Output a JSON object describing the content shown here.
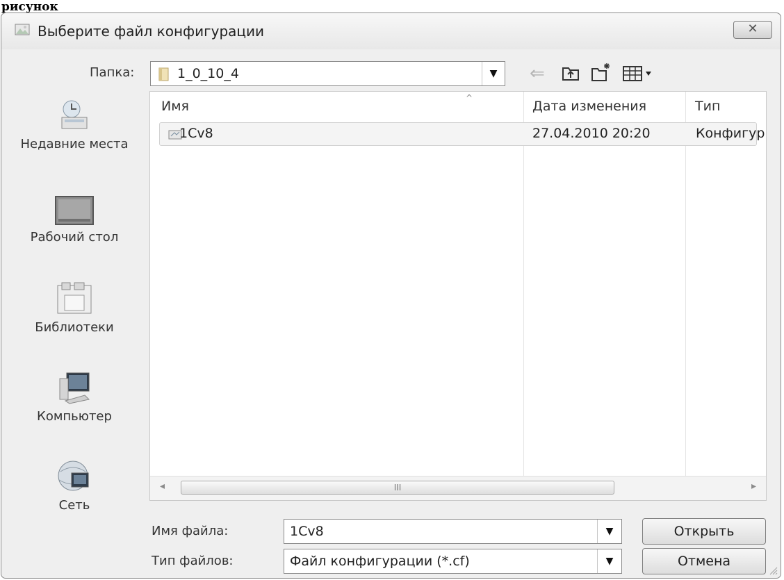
{
  "caption": "рисунок",
  "dialog": {
    "title": "Выберите файл конфигурации",
    "close_glyph": "✕"
  },
  "folder_bar": {
    "label": "Папка:",
    "current_folder": "1_0_10_4",
    "back_icon": "back-arrow-icon",
    "up_icon": "folder-up-icon",
    "new_folder_icon": "new-folder-icon",
    "view_icon": "view-menu-icon"
  },
  "places": [
    {
      "label": "Недавние места",
      "icon": "recent-places-icon"
    },
    {
      "label": "Рабочий стол",
      "icon": "desktop-icon"
    },
    {
      "label": "Библиотеки",
      "icon": "libraries-icon"
    },
    {
      "label": "Компьютер",
      "icon": "computer-icon"
    },
    {
      "label": "Сеть",
      "icon": "network-icon"
    }
  ],
  "file_list": {
    "columns": [
      "Имя",
      "Дата изменения",
      "Тип"
    ],
    "rows": [
      {
        "name": "1Cv8",
        "modified": "27.04.2010 20:20",
        "type": "Конфигур"
      }
    ],
    "scroll_left": "◂",
    "scroll_right": "▸",
    "thumb_grip": "III"
  },
  "file_name": {
    "label": "Имя файла:",
    "value": "1Cv8"
  },
  "file_type": {
    "label": "Тип файлов:",
    "value": "Файл конфигурации (*.cf)"
  },
  "buttons": {
    "open": "Открыть",
    "cancel": "Отмена"
  },
  "colors": {
    "frame": "#8a8a8a",
    "panel": "#efefef",
    "selection": "#f4f4f4"
  }
}
